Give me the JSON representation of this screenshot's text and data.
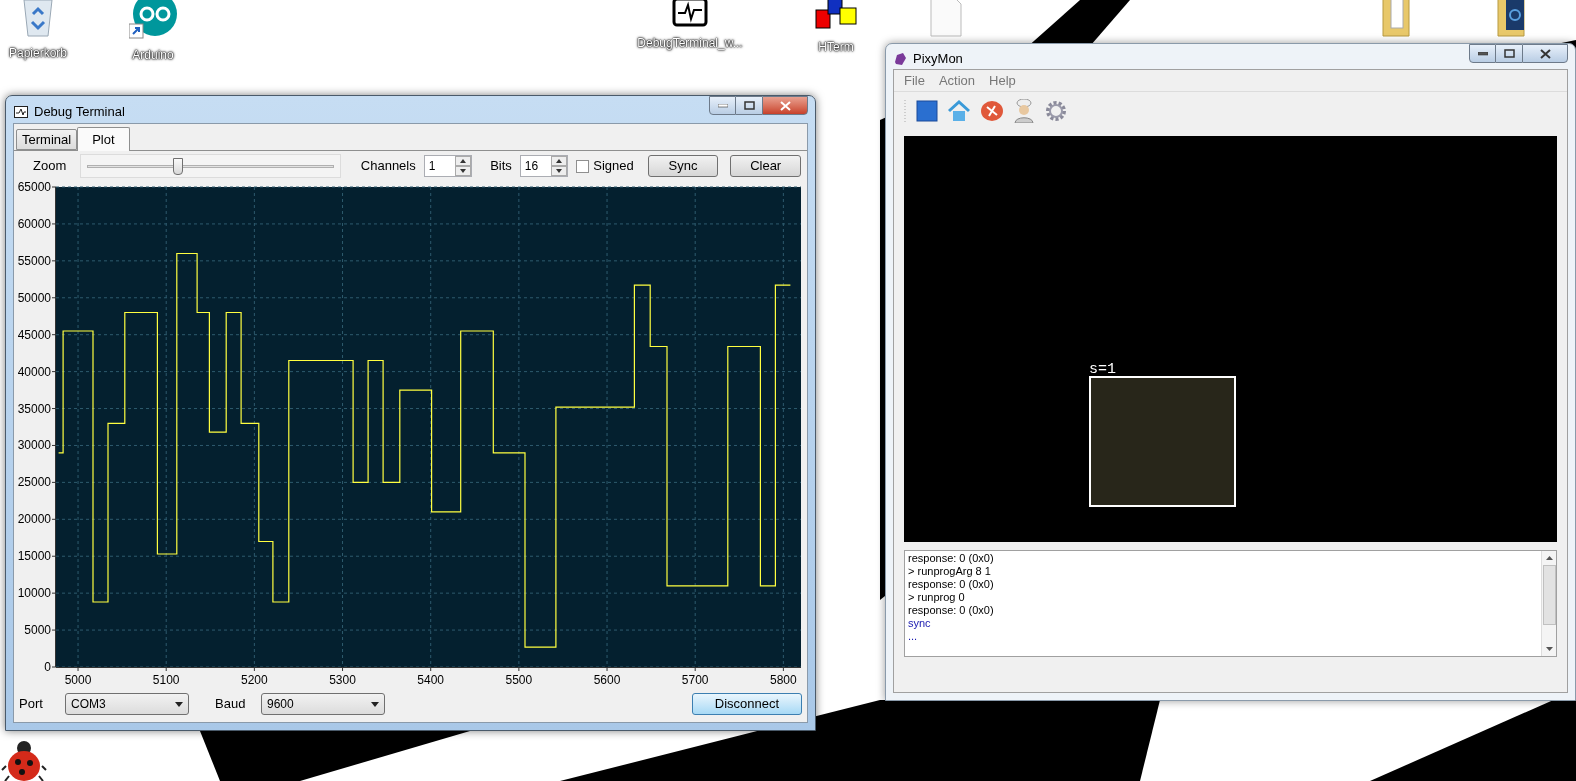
{
  "desktop": {
    "icons": [
      {
        "label": "Papierkorb",
        "kind": "recycle-bin"
      },
      {
        "label": "Arduino",
        "kind": "arduino"
      },
      {
        "label": "DebugTerminal_w...",
        "kind": "debug-terminal"
      },
      {
        "label": "HTerm",
        "kind": "hterm"
      },
      {
        "kind": "file"
      },
      {
        "kind": "folder"
      },
      {
        "kind": "folder-picture"
      },
      {
        "kind": "ladybug"
      }
    ]
  },
  "debug_terminal": {
    "title": "Debug Terminal",
    "tabs": [
      {
        "label": "Terminal",
        "selected": false
      },
      {
        "label": "Plot",
        "selected": true
      }
    ],
    "zoom": {
      "label": "Zoom",
      "level": 0.35
    },
    "channels": {
      "label": "Channels",
      "value": "1"
    },
    "bits": {
      "label": "Bits",
      "value": "16"
    },
    "signed": {
      "label": "Signed",
      "checked": false
    },
    "buttons": [
      "Sync",
      "Clear"
    ],
    "chart_data": {
      "type": "line",
      "grid": true,
      "xlim": [
        4975,
        5820
      ],
      "ylim": [
        0,
        65000
      ],
      "xticks": [
        5000,
        5100,
        5200,
        5300,
        5400,
        5500,
        5600,
        5700,
        5800
      ],
      "yticks": [
        0,
        5000,
        10000,
        15000,
        20000,
        25000,
        30000,
        35000,
        40000,
        45000,
        50000,
        55000,
        60000,
        65000
      ],
      "x": [
        4978,
        4983,
        4983,
        5017,
        5017,
        5034,
        5034,
        5053,
        5053,
        5090,
        5090,
        5112,
        5112,
        5135,
        5135,
        5149,
        5149,
        5168,
        5168,
        5185,
        5185,
        5205,
        5205,
        5221,
        5221,
        5239,
        5239,
        5312,
        5312,
        5329,
        5329,
        5346,
        5346,
        5365,
        5365,
        5401,
        5401,
        5434,
        5434,
        5471,
        5471,
        5507,
        5507,
        5542,
        5542,
        5631,
        5631,
        5649,
        5649,
        5668,
        5668,
        5737,
        5737,
        5774,
        5774,
        5791,
        5791,
        5808
      ],
      "series": [
        {
          "color": "#ffff40",
          "values": [
            29000,
            29000,
            45500,
            45500,
            8800,
            8800,
            33000,
            33000,
            48000,
            48000,
            15300,
            15300,
            56000,
            56000,
            48000,
            48000,
            31800,
            31800,
            48000,
            48000,
            33000,
            33000,
            17000,
            17000,
            8800,
            8800,
            41500,
            41500,
            25000,
            25000,
            41500,
            41500,
            25000,
            25000,
            37500,
            37500,
            21000,
            21000,
            45500,
            45500,
            29000,
            29000,
            2700,
            2700,
            35200,
            35200,
            51700,
            51700,
            43400,
            43400,
            11000,
            11000,
            43400,
            43400,
            11000,
            11000,
            51700,
            51700
          ]
        }
      ]
    },
    "port": {
      "label": "Port",
      "value": "COM3"
    },
    "baud": {
      "label": "Baud",
      "value": "9600"
    },
    "disconnect": "Disconnect"
  },
  "pixymon": {
    "title": "PixyMon",
    "menu": [
      "File",
      "Action",
      "Help"
    ],
    "blocks": [
      {
        "label": "s=1"
      }
    ],
    "console": [
      {
        "text": "response: 0 (0x0)",
        "kind": "output"
      },
      {
        "text": "> runprogArg 8 1",
        "kind": "output"
      },
      {
        "text": "response: 0 (0x0)",
        "kind": "output"
      },
      {
        "text": "> runprog 0",
        "kind": "output"
      },
      {
        "text": "response: 0 (0x0)",
        "kind": "output"
      },
      {
        "text": "sync",
        "kind": "status"
      },
      {
        "text": "...",
        "kind": "status"
      }
    ]
  }
}
